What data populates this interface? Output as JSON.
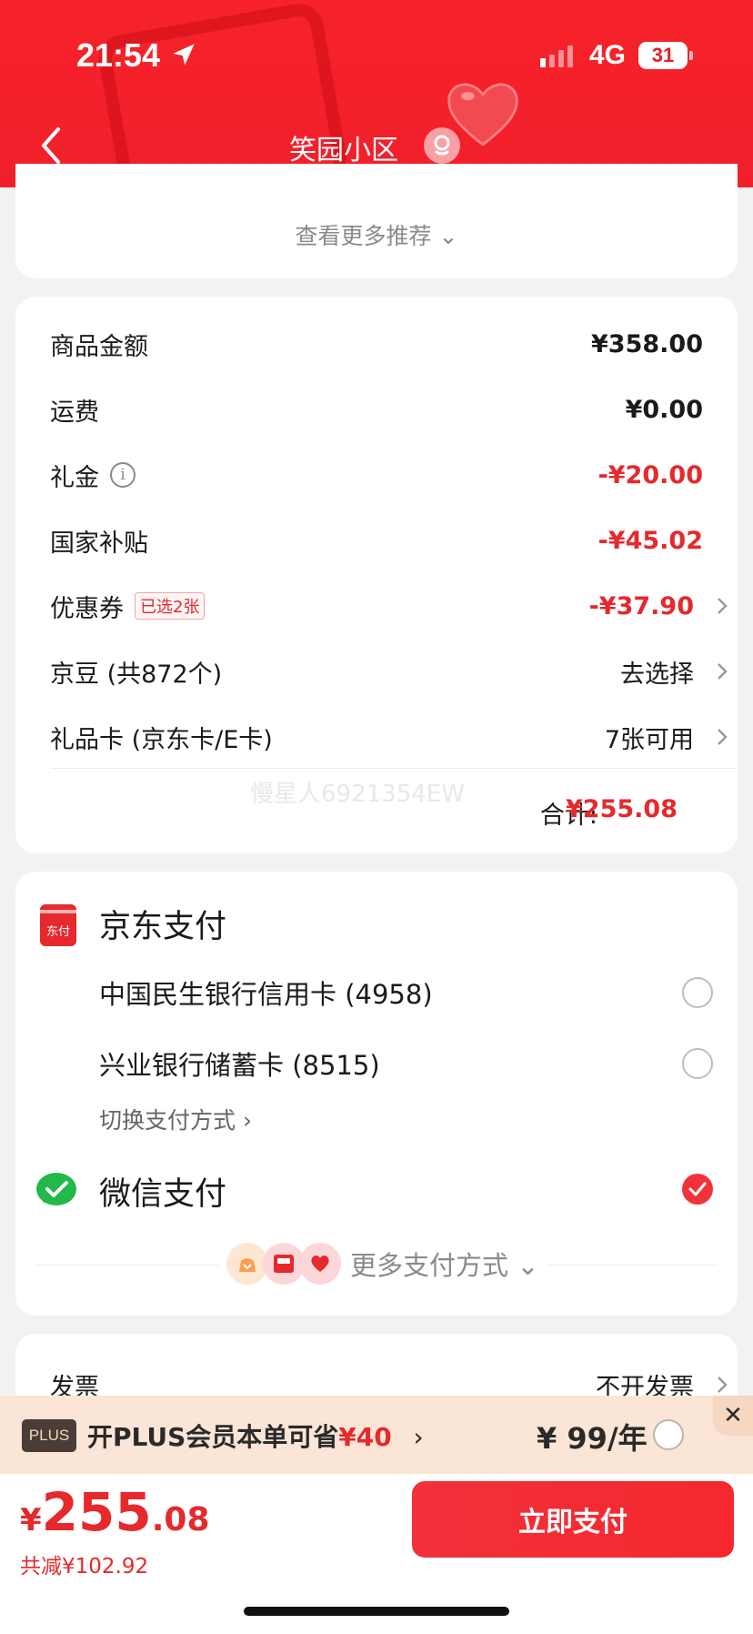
{
  "status_bar": {
    "time": "21:54",
    "network": "4G",
    "battery": "31"
  },
  "header": {
    "title": "笑园小区"
  },
  "recommend": {
    "more_label": "查看更多推荐 ⌄"
  },
  "price_rows": [
    {
      "label": "商品金额",
      "value": "¥358.00"
    },
    {
      "label": "运费",
      "value": "¥0.00"
    },
    {
      "label": "礼金",
      "value": "-¥20.00"
    },
    {
      "label": "国家补贴",
      "value": "-¥45.02"
    },
    {
      "label": "优惠券",
      "tag": "已选2张",
      "value": "-¥37.90"
    },
    {
      "label": "京豆 (共872个)",
      "value": "去选择"
    },
    {
      "label": "礼品卡 (京东卡/E卡)",
      "value": "7张可用"
    }
  ],
  "watermark": "慢星人6921354EW",
  "summary": {
    "total_label": "合计:",
    "total_value": "¥255.08"
  },
  "payment": {
    "jd_pay_title": "京东支付",
    "jd_icon_text": "东付",
    "banks": [
      {
        "name": "中国民生银行信用卡 (4958)",
        "selected": false
      },
      {
        "name": "兴业银行储蓄卡 (8515)",
        "selected": false
      }
    ],
    "switch_label": "切换支付方式 ›",
    "wechat_title": "微信支付",
    "wechat_selected": true,
    "more_label": "更多支付方式 ⌄"
  },
  "invoice": {
    "label": "发票",
    "value": "不开发票"
  },
  "plus": {
    "badge": "PLUS",
    "text": "开PLUS会员本单可省",
    "save": "¥40",
    "arrow": "›",
    "price": "¥ 99/年",
    "close": "✕"
  },
  "footer": {
    "currency": "¥",
    "amount_int": "255",
    "amount_dec": ".08",
    "saved": "共减¥102.92",
    "pay_button": "立即支付"
  },
  "colors": {
    "brand_red": "#f0202a",
    "price_red": "#e5292d",
    "plus_bg": "#fbe5d6"
  }
}
